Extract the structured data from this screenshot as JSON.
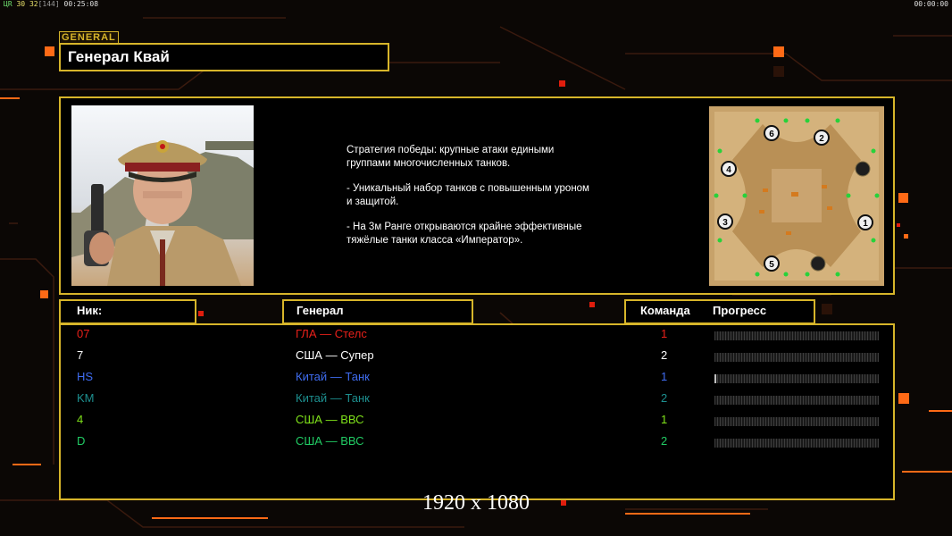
{
  "hud": {
    "fps_prefix": "ЦR",
    "fps_a": "30",
    "fps_b": "32",
    "fps_c": "[144]",
    "elapsed": "00:25:08",
    "clock": "00:00:00"
  },
  "header": {
    "section_tag": "GENERAL",
    "general_name": "Генерал Квай"
  },
  "description": {
    "lines": [
      "Стратегия победы: крупные атаки едиными\n группами многочисленных танков.",
      "- Уникальный набор танков с повышенным уроном\n и защитой.",
      "- На 3м Ранге открываются крайне эффективные\n тяжёлые танки класса «Император»."
    ]
  },
  "minimap": {
    "slots": [
      "1",
      "2",
      "3",
      "4",
      "5",
      "6"
    ]
  },
  "columns": {
    "nick": "Ник:",
    "general": "Генерал",
    "team": "Команда",
    "progress": "Прогресс"
  },
  "players": [
    {
      "nick": "07",
      "general": "ГЛА — Стелс",
      "team": "1",
      "color": "#e8201a",
      "progress": 0
    },
    {
      "nick": "7",
      "general": "США — Супер",
      "team": "2",
      "color": "#ffffff",
      "progress": 0
    },
    {
      "nick": "HS",
      "general": "Китай — Танк",
      "team": "1",
      "color": "#3f6cf0",
      "progress": 0.01
    },
    {
      "nick": "KM",
      "general": "Китай — Танк",
      "team": "2",
      "color": "#1d8f8f",
      "progress": 0
    },
    {
      "nick": "4",
      "general": "США — ВВС",
      "team": "1",
      "color": "#7fe21a",
      "progress": 0
    },
    {
      "nick": "D",
      "general": "США — ВВС",
      "team": "2",
      "color": "#21cc64",
      "progress": 0
    }
  ],
  "resolution_label": "1920 x 1080",
  "colors": {
    "accent": "#d7b52a",
    "orange": "#ff7a1a",
    "background": "#0b0705"
  },
  "icons": {
    "portrait": "general-portrait",
    "minimap": "map-preview"
  }
}
